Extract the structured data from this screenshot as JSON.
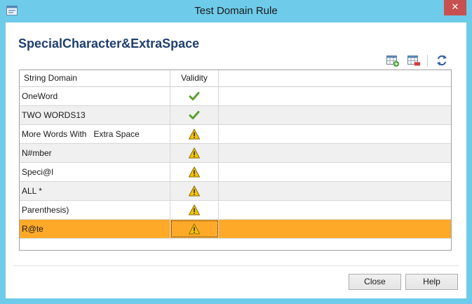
{
  "window": {
    "title": "Test Domain Rule",
    "close_glyph": "✕"
  },
  "heading": "SpecialCharacter&ExtraSpace",
  "toolbar": {
    "icons": [
      "add-row-icon",
      "delete-row-icon",
      "refresh-icon"
    ]
  },
  "grid": {
    "columns": [
      "String Domain",
      "Validity"
    ],
    "rows": [
      {
        "value": "OneWord",
        "validity": "valid"
      },
      {
        "value": "TWO WORDS13",
        "validity": "valid"
      },
      {
        "value": "More Words With   Extra Space",
        "validity": "warning"
      },
      {
        "value": "N#mber",
        "validity": "warning"
      },
      {
        "value": "Speci@l",
        "validity": "warning"
      },
      {
        "value": "ALL *",
        "validity": "warning"
      },
      {
        "value": "Parenthesis)",
        "validity": "warning"
      },
      {
        "value": "R@te",
        "validity": "warning",
        "selected": true
      }
    ]
  },
  "buttons": {
    "close": "Close",
    "help": "Help"
  },
  "colors": {
    "selection": "#fea928",
    "heading": "#1f3f6e",
    "valid": "#5aa02c",
    "warning": "#f5c300"
  }
}
